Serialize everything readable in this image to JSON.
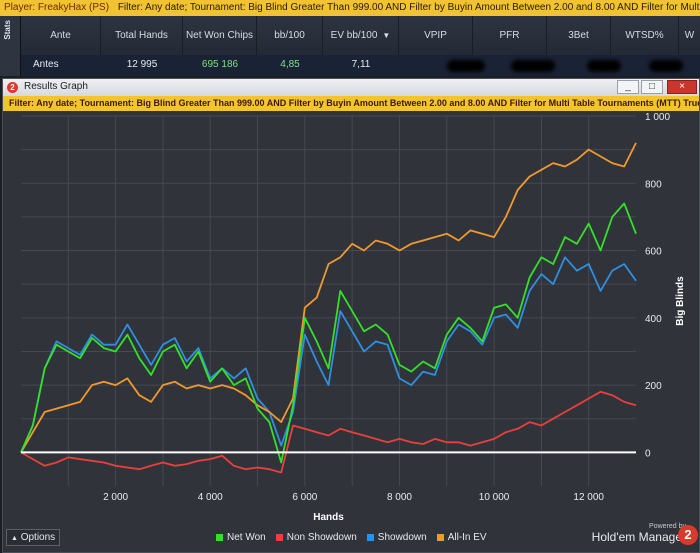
{
  "top_filter": {
    "player": "Player: FreakyHax (PS)",
    "filter": "Filter: Any date; Tournament: Big Blind Greater Than 999.00 AND Filter by Buyin Amount  Between 2.00 and 8.00 AND Filter for Multi Table Tournaments"
  },
  "stats": {
    "side_label": "Stats",
    "headers": [
      "Ante",
      "Total Hands",
      "Net Won Chips",
      "bb/100",
      "EV bb/100",
      "VPIP",
      "PFR",
      "3Bet",
      "WTSD%"
    ],
    "row": [
      "Antes",
      "12 995",
      "695 186",
      "4,85",
      "7,11"
    ]
  },
  "window": {
    "title": "Results Graph",
    "badge": "2",
    "filter": "Filter: Any date; Tournament: Big Blind Greater Than 999.00 AND Filter by Buyin Amount  Between 2.00 and 8.00 AND Filter for Multi Table Tournaments (MTT) True; Game Ty",
    "buttons": [
      "_",
      "□",
      "×"
    ]
  },
  "footer": {
    "options": "Options",
    "powered": "Powered by",
    "brand": "Hold'em Manager",
    "brand_badge": "2"
  },
  "colors": {
    "net_won": "#33e02a",
    "non_showdown": "#e8403c",
    "showdown": "#2f8fe0",
    "all_in_ev": "#f2992e",
    "zero_line": "#ffffff"
  },
  "chart_data": {
    "type": "line",
    "xlabel": "Hands",
    "ylabel": "Big Blinds",
    "xlim": [
      0,
      13000
    ],
    "ylim": [
      -100,
      1000
    ],
    "x_ticks": [
      2000,
      4000,
      6000,
      8000,
      10000,
      12000
    ],
    "x_tick_labels": [
      "2 000",
      "4 000",
      "6 000",
      "8 000",
      "10 000",
      "12 000"
    ],
    "y_ticks": [
      0,
      200,
      400,
      600,
      800,
      1000
    ],
    "y_tick_labels": [
      "0",
      "200",
      "400",
      "600",
      "800",
      "1 000"
    ],
    "grid": true,
    "legend_position": "bottom",
    "x": [
      0,
      250,
      500,
      750,
      1000,
      1250,
      1500,
      1750,
      2000,
      2250,
      2500,
      2750,
      3000,
      3250,
      3500,
      3750,
      4000,
      4250,
      4500,
      4750,
      5000,
      5250,
      5500,
      5750,
      6000,
      6250,
      6500,
      6750,
      7000,
      7250,
      7500,
      7750,
      8000,
      8250,
      8500,
      8750,
      9000,
      9250,
      9500,
      9750,
      10000,
      10250,
      10500,
      10750,
      11000,
      11250,
      11500,
      11750,
      12000,
      12250,
      12500,
      12750,
      13000
    ],
    "series": [
      {
        "name": "Net Won",
        "values": [
          0,
          80,
          250,
          320,
          300,
          280,
          340,
          310,
          300,
          350,
          280,
          230,
          300,
          320,
          250,
          300,
          210,
          250,
          200,
          220,
          130,
          90,
          -30,
          140,
          400,
          330,
          250,
          480,
          420,
          360,
          380,
          350,
          260,
          240,
          270,
          250,
          350,
          400,
          370,
          330,
          430,
          440,
          400,
          520,
          580,
          560,
          640,
          620,
          680,
          600,
          700,
          740,
          650
        ]
      },
      {
        "name": "Non Showdown",
        "values": [
          0,
          -20,
          -40,
          -30,
          -15,
          -20,
          -25,
          -30,
          -40,
          -45,
          -50,
          -40,
          -30,
          -40,
          -35,
          -25,
          -20,
          -10,
          -40,
          -50,
          -45,
          -50,
          -60,
          80,
          70,
          60,
          50,
          70,
          60,
          50,
          40,
          30,
          40,
          30,
          25,
          40,
          30,
          30,
          20,
          30,
          40,
          60,
          70,
          90,
          80,
          100,
          120,
          140,
          160,
          180,
          170,
          150,
          140
        ]
      },
      {
        "name": "Showdown",
        "values": [
          0,
          80,
          250,
          330,
          310,
          290,
          350,
          320,
          320,
          380,
          320,
          260,
          320,
          340,
          270,
          310,
          220,
          250,
          220,
          250,
          160,
          120,
          20,
          120,
          350,
          270,
          200,
          420,
          360,
          300,
          330,
          320,
          220,
          200,
          240,
          230,
          330,
          380,
          360,
          320,
          400,
          410,
          370,
          480,
          530,
          500,
          580,
          540,
          560,
          480,
          540,
          560,
          510
        ]
      },
      {
        "name": "All-In EV",
        "values": [
          0,
          60,
          120,
          130,
          140,
          150,
          200,
          210,
          200,
          220,
          170,
          150,
          200,
          210,
          190,
          200,
          190,
          200,
          190,
          170,
          140,
          120,
          90,
          160,
          430,
          460,
          560,
          580,
          620,
          600,
          630,
          620,
          600,
          620,
          630,
          640,
          650,
          630,
          660,
          650,
          640,
          700,
          780,
          820,
          840,
          860,
          850,
          870,
          900,
          880,
          860,
          850,
          920
        ]
      }
    ]
  }
}
